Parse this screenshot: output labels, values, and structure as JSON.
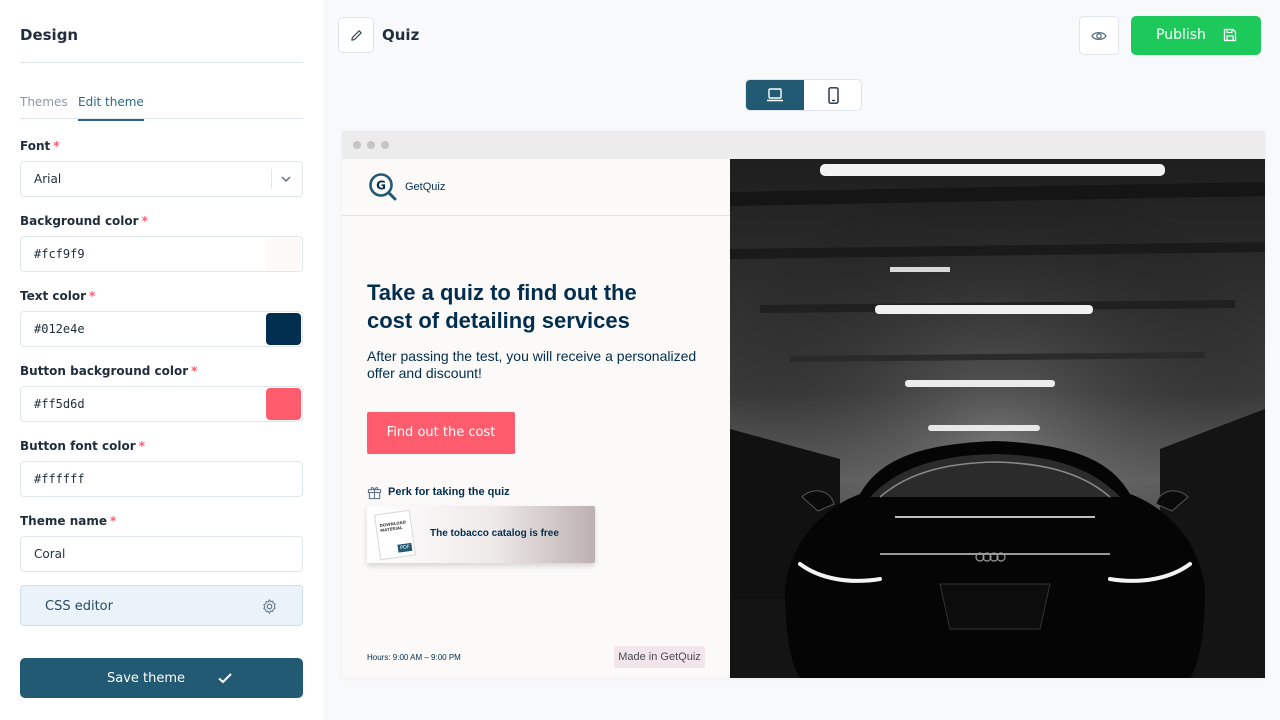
{
  "sidebar": {
    "title": "Design",
    "tabs": [
      {
        "label": "Themes",
        "active": false
      },
      {
        "label": "Edit theme",
        "active": true
      }
    ],
    "fields": {
      "font": {
        "label": "Font",
        "value": "Arial"
      },
      "background_color": {
        "label": "Background color",
        "value": "#fcf9f9",
        "swatch": "#fcf9f9"
      },
      "text_color": {
        "label": "Text color",
        "value": "#012e4e",
        "swatch": "#012e4e"
      },
      "button_background_color": {
        "label": "Button background color",
        "value": "#ff5d6d",
        "swatch": "#ff5d6d"
      },
      "button_font_color": {
        "label": "Button font color",
        "value": "#ffffff",
        "swatch": "#ffffff"
      },
      "theme_name": {
        "label": "Theme name",
        "value": "Coral"
      }
    },
    "required_mark": "*",
    "css_editor_label": "CSS editor",
    "save_label": "Save theme"
  },
  "topbar": {
    "title": "Quiz",
    "publish_label": "Publish",
    "publish_color": "#1dc95b"
  },
  "device_toggle": {
    "selected": "desktop",
    "icons": [
      "laptop-icon",
      "smartphone-icon"
    ]
  },
  "preview": {
    "brand": "GetQuiz",
    "headline": "Take a quiz to find out the cost of detailing services",
    "subtext": "After passing the test, you will receive a personalized offer and discount!",
    "cta_label": "Find out the cost",
    "perk_title": "Perk for taking the quiz",
    "perk_doc_text": "DOWNLOAD MATERIAL",
    "perk_doc_badge": "PDF",
    "perk_text": "The tobacco catalog is free",
    "hours": "Hours: 9:00 AM – 9:00 PM",
    "made_in": "Made in GetQuiz"
  },
  "colors": {
    "accent": "#235a73",
    "required": "#ff5d6d",
    "text": "#012e4e",
    "button": "#ff5d6d"
  }
}
